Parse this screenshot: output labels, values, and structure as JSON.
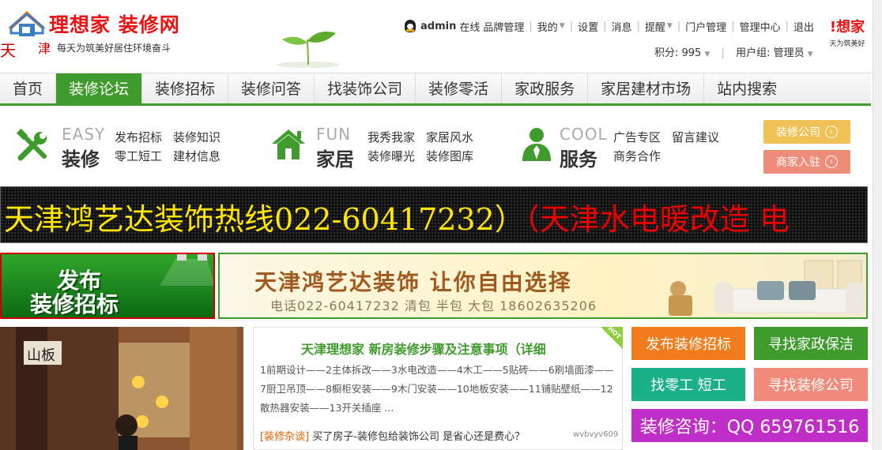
{
  "header": {
    "logo_title": "理想家 装修网",
    "logo_city_1": "天",
    "logo_city_2": "津",
    "logo_slogan": "每天为筑美好居住环境奋斗",
    "user_name": "admin",
    "status": "在线",
    "brand_mgmt": "品牌管理",
    "my_menu": "我的",
    "settings": "设置",
    "messages": "消息",
    "reminders": "提醒",
    "portal_mgmt": "门户管理",
    "admin_center": "管理中心",
    "logout": "退出",
    "points_label": "积分: 995",
    "user_group_label": "用户组: 管理员",
    "side_logo_title": "!想家",
    "side_logo_sub": "天为筑美好"
  },
  "nav": {
    "items": [
      {
        "label": "首页"
      },
      {
        "label": "装修论坛"
      },
      {
        "label": "装修招标"
      },
      {
        "label": "装修问答"
      },
      {
        "label": "找装饰公司"
      },
      {
        "label": "装修零活"
      },
      {
        "label": "家政服务"
      },
      {
        "label": "家居建材市场"
      },
      {
        "label": "站内搜索"
      }
    ],
    "active_index": 1
  },
  "categories": [
    {
      "en": "EASY",
      "zh": "装修",
      "links": [
        "发布招标",
        "装修知识",
        "零工短工",
        "建材信息"
      ]
    },
    {
      "en": "FUN",
      "zh": "家居",
      "links": [
        "我秀我家",
        "家居风水",
        "装修曝光",
        "装修图库"
      ]
    },
    {
      "en": "COOL",
      "zh": "服务",
      "links": [
        "广告专区",
        "留言建议",
        "商务合作"
      ]
    }
  ],
  "pills": {
    "company": "装修公司",
    "merchant": "商家入驻"
  },
  "led": {
    "text_yellow": "天津鸿艺达装饰热线022-60417232）",
    "text_red": "（天津水电暖改造 电"
  },
  "ads": {
    "publish_line1": "发布",
    "publish_line2": "装修招标",
    "hyd_headline": "天津鸿艺达装饰  让你自由选择",
    "hyd_phone": "电话022-60417232  清包 半包 大包  18602635206"
  },
  "photo": {
    "sign_text": "山板"
  },
  "article": {
    "title": "天津理想家 新房装修步骤及注意事项（详细",
    "body": "1前期设计——2主体拆改——3水电改造——4木工——5贴砖——6刷墙面漆——7厨卫吊顶——8橱柜安装——9木门安装——10地板安装——11铺贴壁纸——12散热器安装——13开关插座 ...",
    "news_tag": "[装修杂谈]",
    "news_title": "买了房子-装修包给装饰公司 是省心还是费心？",
    "news_user": "wvbvyv609",
    "hot_label": "HOT"
  },
  "quick_buttons": {
    "publish_tender": "发布装修招标",
    "find_cleaning": "寻找家政保洁",
    "find_laborer": "找零工 短工",
    "find_company": "寻找装修公司",
    "consult": "装修咨询：QQ 659761516"
  },
  "colors": {
    "brand_green": "#3e9b2c",
    "orange": "#f07c1b",
    "teal": "#1bb08a",
    "salmon": "#f08a7a",
    "magenta": "#c02ec8",
    "pill_yellow": "#f0c255",
    "pill_salmon": "#ee8c7a"
  }
}
